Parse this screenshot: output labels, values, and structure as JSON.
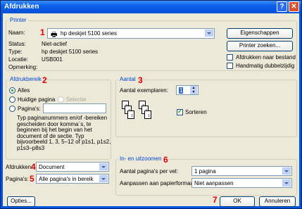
{
  "window": {
    "title": "Afdrukken",
    "help_glyph": "?",
    "close_glyph": "✕"
  },
  "printer": {
    "group_title": "Printer",
    "name_label": "Naam:",
    "name_value": "hp deskjet 5100 series",
    "status_label": "Status:",
    "status_value": "Niet-actief",
    "type_label": "Type:",
    "type_value": "hp deskjet 5100 series",
    "location_label": "Locatie:",
    "location_value": "USB001",
    "comment_label": "Opmerking:",
    "comment_value": "",
    "properties_button": "Eigenschappen",
    "find_printer_button": "Printer zoeken...",
    "print_to_file_label": "Afdrukken naar bestand",
    "print_to_file_checked": false,
    "manual_duplex_label": "Handmatig dubbelzijdig",
    "manual_duplex_checked": false
  },
  "range": {
    "group_title": "Afdrukbereik",
    "all_label": "Alles",
    "current_label": "Huidige pagina",
    "selection_label": "Selectie",
    "pages_label": "Pagina's:",
    "pages_value": "",
    "help_text": [
      "Typ paginanummers en/of -bereiken",
      "gescheiden door komma´s, te",
      "beginnen bij het begin van het",
      "document of de sectie. Typ",
      "bijvoorbeeld 1, 3, 5–12 of p1s1, p1s2,",
      "p1s3–p8s3"
    ],
    "selected": "all"
  },
  "copies": {
    "group_title": "Aantal",
    "copies_label": "Aantal exemplaren:",
    "copies_value": "1",
    "collate_label": "Sorteren",
    "collate_checked": true,
    "page_numbers": [
      "1",
      "2",
      "3"
    ]
  },
  "print_what": {
    "label": "Afdrukken:",
    "value": "Document"
  },
  "print_pages": {
    "label": "Pagina's:",
    "value": "Alle pagina's in bereik"
  },
  "zoom": {
    "group_title": "In- en uitzoomen",
    "per_sheet_label": "Aantal pagina's per vel:",
    "per_sheet_value": "1 pagina",
    "scale_label": "Aanpassen aan papierformaat:",
    "scale_value": "Niet aanpassen"
  },
  "buttons": {
    "options": "Opties...",
    "ok": "OK",
    "cancel": "Annuleren"
  },
  "callouts": [
    "1",
    "2",
    "3",
    "4",
    "5",
    "6",
    "7"
  ],
  "colors": {
    "callout": "#e10000",
    "group_title": "#0046d5",
    "titlebar": "#0a5fe8",
    "dialog_bg": "#ece9d8"
  }
}
